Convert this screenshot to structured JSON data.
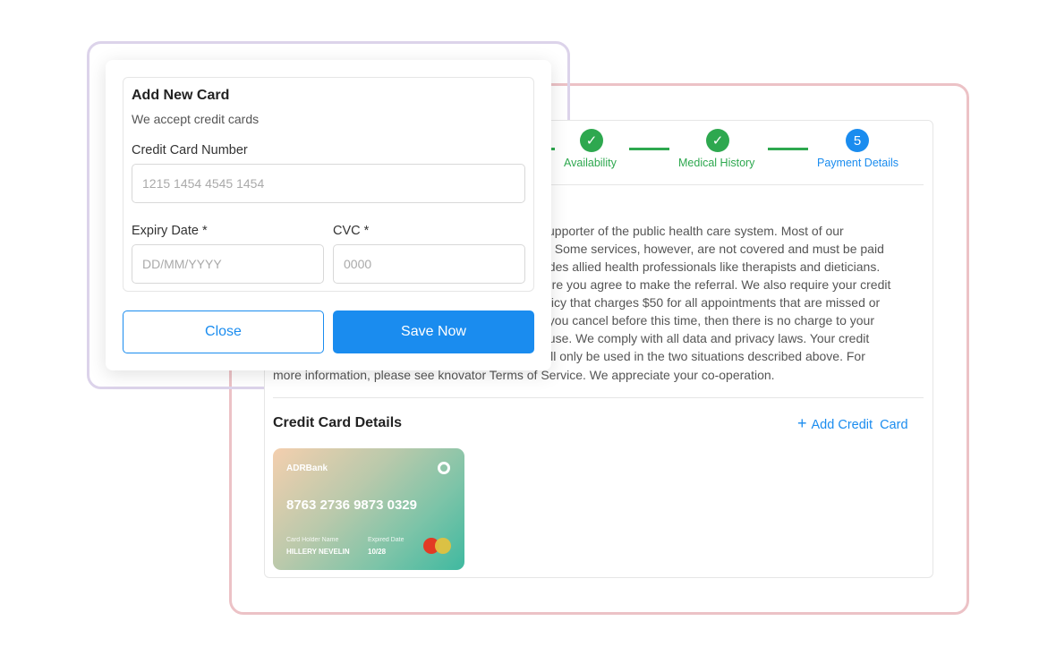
{
  "stepper": {
    "steps": [
      {
        "label": "Availability",
        "status": "done"
      },
      {
        "label": "Medical History",
        "status": "done"
      },
      {
        "label": "Payment Details",
        "number": "5",
        "status": "active"
      }
    ]
  },
  "policy_lines": [
    "supporter of the public health care system. Most of our",
    "s. Some services, however, are not covered and must be paid",
    "udes allied health professionals like therapists and dieticians.",
    "fore you agree to make the referral. We also require your credit",
    "olicy that charges $50 for all appointments that are missed or",
    "f you cancel before this time, then there is no charge to your",
    "buse. We comply with all data and privacy laws. Your credit",
    "vill only be used in the two situations described above. For",
    "more information, please see knovator Terms of Service. We appreciate your co-operation."
  ],
  "credit_section": {
    "title": "Credit Card Details",
    "add_label": "Add Credit  Card"
  },
  "card": {
    "bank": "ADRBank",
    "number": "8763 2736 9873 0329",
    "holder_label": "Card Holder Name",
    "holder": "HILLERY NEVELIN",
    "expiry_label": "Expired Date",
    "expiry": "10/28"
  },
  "modal": {
    "title": "Add New Card",
    "subtitle": "We accept credit cards",
    "number_label": "Credit Card Number",
    "number_placeholder": "1215 1454 4545 1454",
    "expiry_label": "Expiry Date *",
    "expiry_placeholder": "DD/MM/YYYY",
    "cvc_label": "CVC *",
    "cvc_placeholder": "0000",
    "close": "Close",
    "save": "Save Now"
  },
  "colors": {
    "primary": "#1a8cef",
    "success": "#2ea84f"
  }
}
